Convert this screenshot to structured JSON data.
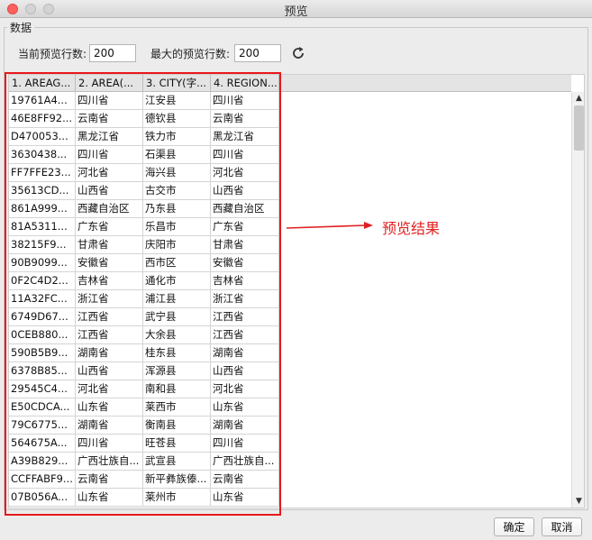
{
  "window": {
    "title": "预览"
  },
  "group": {
    "label": "数据"
  },
  "controls": {
    "current_rows_label": "当前预览行数:",
    "current_rows_value": "200",
    "max_rows_label": "最大的预览行数:",
    "max_rows_value": "200",
    "refresh_icon": "refresh-icon"
  },
  "table": {
    "columns": [
      "1. AREAG...",
      "2. AREA(...",
      "3. CITY(字...",
      "4. REGION..."
    ],
    "rows": [
      [
        "19761A4...",
        "四川省",
        "江安县",
        "四川省"
      ],
      [
        "46E8FF92...",
        "云南省",
        "德钦县",
        "云南省"
      ],
      [
        "D470053...",
        "黑龙江省",
        "铁力市",
        "黑龙江省"
      ],
      [
        "3630438...",
        "四川省",
        "石渠县",
        "四川省"
      ],
      [
        "FF7FFE23...",
        "河北省",
        "海兴县",
        "河北省"
      ],
      [
        "35613CD...",
        "山西省",
        "古交市",
        "山西省"
      ],
      [
        "861A999...",
        "西藏自治区",
        "乃东县",
        "西藏自治区"
      ],
      [
        "81A5311...",
        "广东省",
        "乐昌市",
        "广东省"
      ],
      [
        "38215F9...",
        "甘肃省",
        "庆阳市",
        "甘肃省"
      ],
      [
        "90B9099...",
        "安徽省",
        "西市区",
        "安徽省"
      ],
      [
        "0F2C4D2...",
        "吉林省",
        "通化市",
        "吉林省"
      ],
      [
        "11A32FC...",
        "浙江省",
        "浦江县",
        "浙江省"
      ],
      [
        "6749D67...",
        "江西省",
        "武宁县",
        "江西省"
      ],
      [
        "0CEB880...",
        "江西省",
        "大余县",
        "江西省"
      ],
      [
        "590B5B9...",
        "湖南省",
        "桂东县",
        "湖南省"
      ],
      [
        "6378B85...",
        "山西省",
        "浑源县",
        "山西省"
      ],
      [
        "29545C4...",
        "河北省",
        "南和县",
        "河北省"
      ],
      [
        "E50CDCA...",
        "山东省",
        "莱西市",
        "山东省"
      ],
      [
        "79C6775...",
        "湖南省",
        "衡南县",
        "湖南省"
      ],
      [
        "564675A...",
        "四川省",
        "旺苍县",
        "四川省"
      ],
      [
        "A39B829...",
        "广西壮族自...",
        "武宣县",
        "广西壮族自..."
      ],
      [
        "CCFFABF9...",
        "云南省",
        "新平彝族傣...",
        "云南省"
      ],
      [
        "07B056A...",
        "山东省",
        "莱州市",
        "山东省"
      ]
    ]
  },
  "annotation": {
    "text": "预览结果"
  },
  "buttons": {
    "ok": "确定",
    "cancel": "取消"
  }
}
